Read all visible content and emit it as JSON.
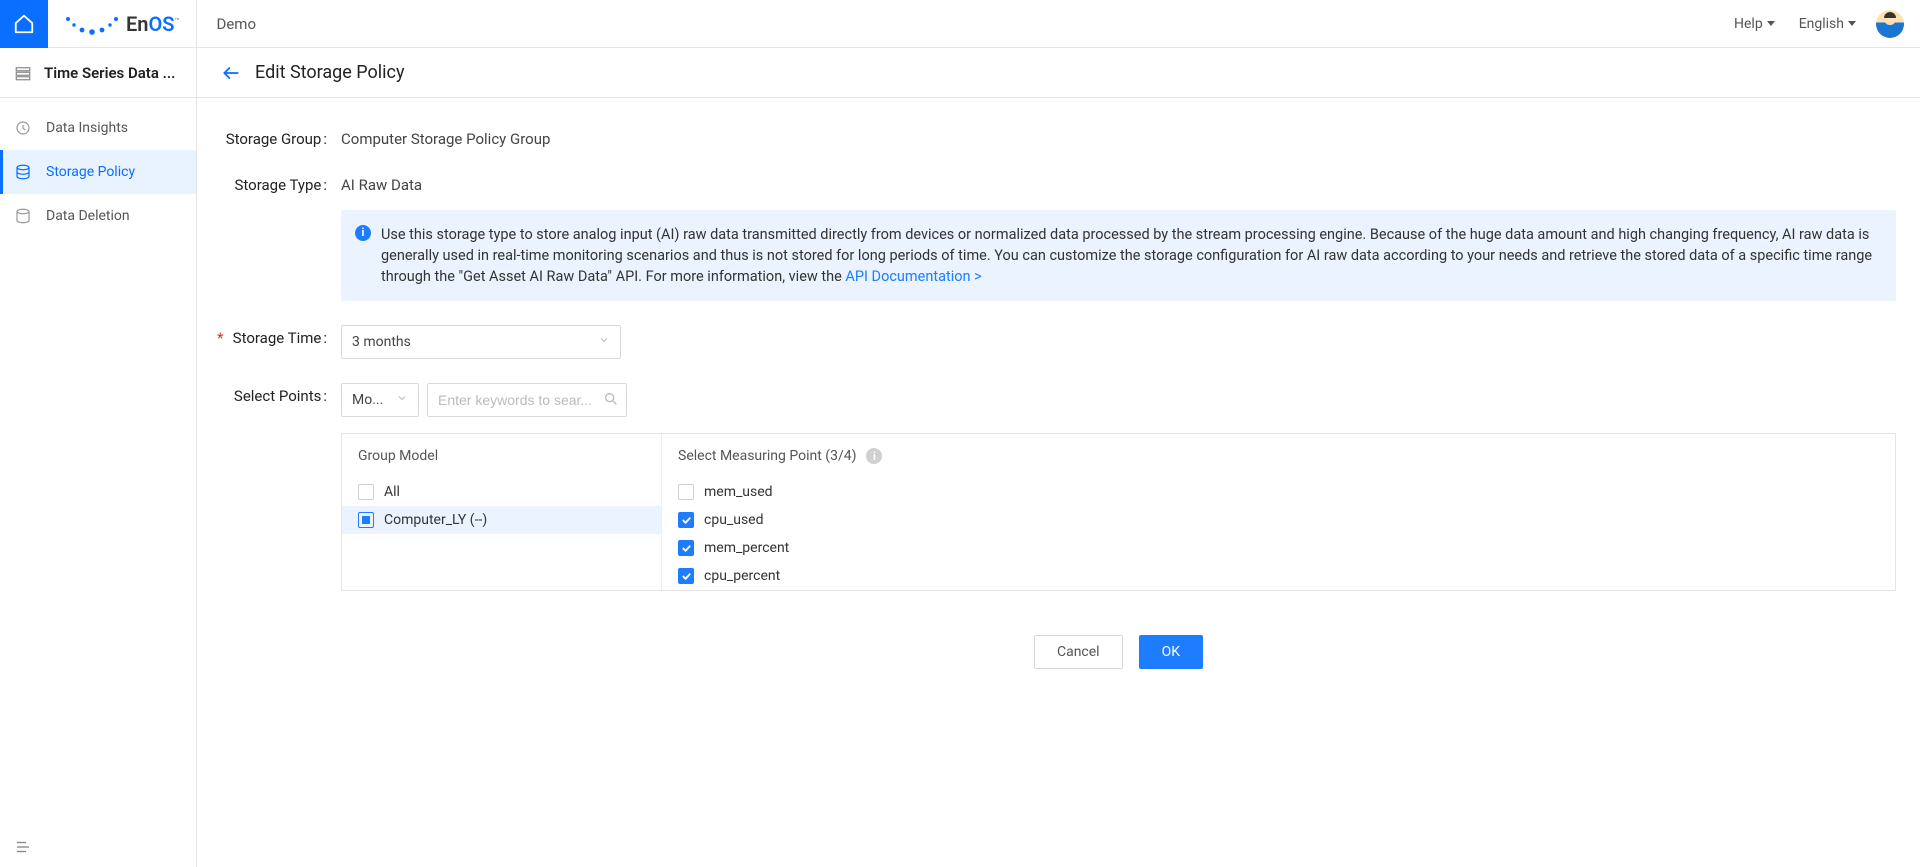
{
  "header": {
    "brand_en": "En",
    "brand_os": "OS",
    "brand_tm": "™",
    "breadcrumb": "Demo",
    "help": "Help",
    "language": "English"
  },
  "sidebar": {
    "title": "Time Series Data ...",
    "items": [
      {
        "label": "Data Insights"
      },
      {
        "label": "Storage Policy"
      },
      {
        "label": "Data Deletion"
      }
    ]
  },
  "page": {
    "title": "Edit Storage Policy"
  },
  "form": {
    "storage_group_label": "Storage Group",
    "storage_group_value": "Computer Storage Policy Group",
    "storage_type_label": "Storage Type",
    "storage_type_value": "AI Raw Data",
    "info_text": "Use this storage type to store analog input (AI) raw data transmitted directly from devices or normalized data processed by the stream processing engine. Because of the huge data amount and high changing frequency, AI raw data is generally used in real-time monitoring scenarios and thus is not stored for long periods of time. You can customize the storage configuration for AI raw data according to your needs and retrieve the stored data of a specific time range through the \"Get Asset AI Raw Data\" API. For more information, view the ",
    "info_link": "API Documentation >",
    "storage_time_label": "Storage Time",
    "storage_time_value": "3 months",
    "select_points_label": "Select Points",
    "model_filter": "Mo...",
    "search_placeholder": "Enter keywords to sear...",
    "group_model_header": "Group Model",
    "select_mp_header": "Select Measuring Point (3/4)",
    "models": {
      "all": "All",
      "computer": "Computer_LY (--)"
    },
    "points": [
      {
        "name": "mem_used",
        "checked": false
      },
      {
        "name": "cpu_used",
        "checked": true
      },
      {
        "name": "mem_percent",
        "checked": true
      },
      {
        "name": "cpu_percent",
        "checked": true
      }
    ],
    "cancel": "Cancel",
    "ok": "OK"
  }
}
